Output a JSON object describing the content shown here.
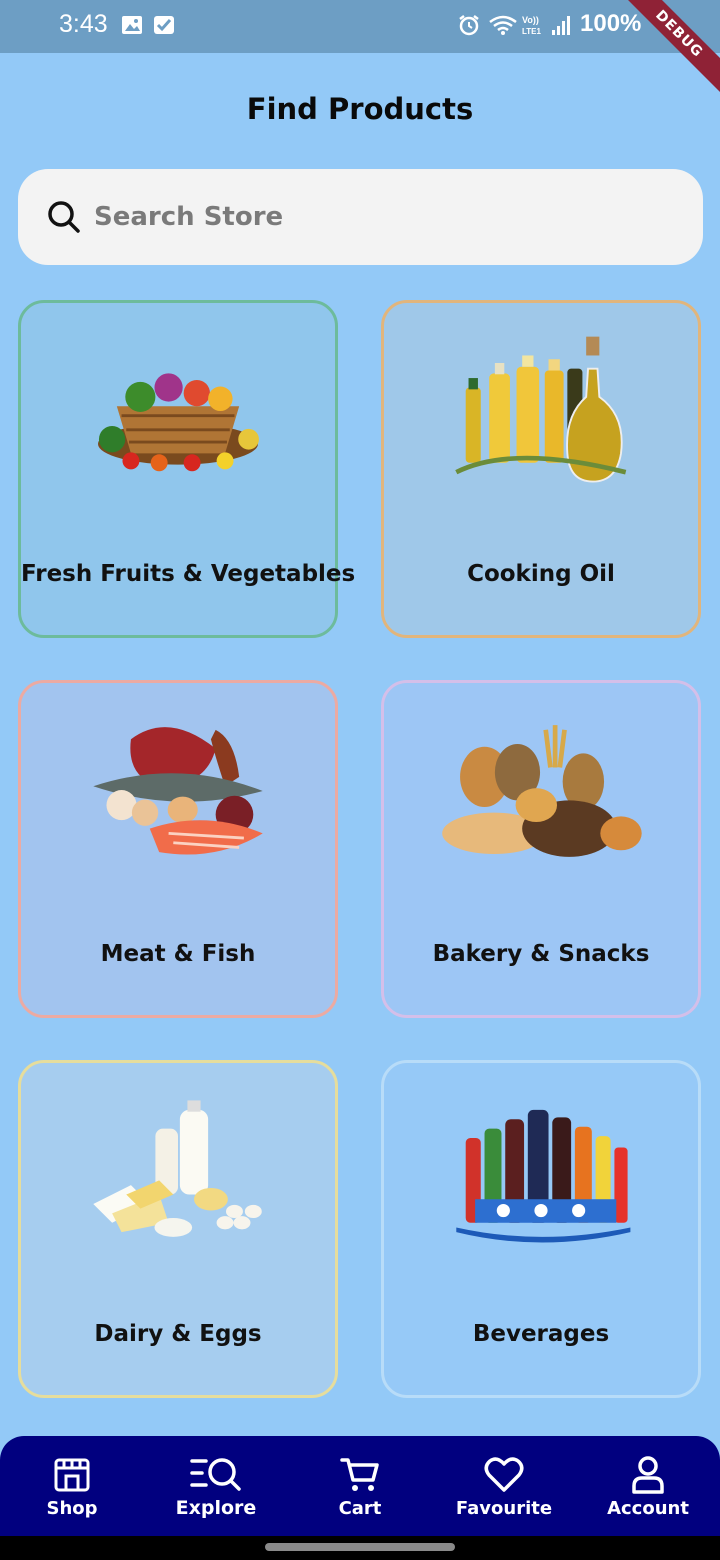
{
  "status_bar": {
    "time": "3:43",
    "battery": "100%",
    "ribbon": "DEBUG"
  },
  "page": {
    "title": "Find Products"
  },
  "search": {
    "placeholder": "Search Store",
    "value": ""
  },
  "categories": [
    {
      "label": "Fresh Fruits & Vegetables",
      "icon": "fruits-vegetables-basket-image",
      "border": "#6dbb9c",
      "bg": "#90c6ec"
    },
    {
      "label": "Cooking Oil",
      "icon": "cooking-oil-bottles-image",
      "border": "#e1b57c",
      "bg": "#9fc8e9"
    },
    {
      "label": "Meat & Fish",
      "icon": "meat-fish-image",
      "border": "#ecaaa2",
      "bg": "#a2c4ef"
    },
    {
      "label": "Bakery & Snacks",
      "icon": "bakery-bread-image",
      "border": "#d4bfe9",
      "bg": "#9dc6f5"
    },
    {
      "label": "Dairy & Eggs",
      "icon": "dairy-eggs-image",
      "border": "#e6dd9c",
      "bg": "#a6cdef"
    },
    {
      "label": "Beverages",
      "icon": "beverage-bottles-image",
      "border": "#b8dcf8",
      "bg": "#96c9f7"
    }
  ],
  "bottom_nav": {
    "items": [
      {
        "label": "Shop",
        "icon": "shop-icon"
      },
      {
        "label": "Explore",
        "icon": "explore-icon"
      },
      {
        "label": "Cart",
        "icon": "cart-icon"
      },
      {
        "label": "Favourite",
        "icon": "heart-icon"
      },
      {
        "label": "Account",
        "icon": "account-icon"
      }
    ]
  },
  "colors": {
    "background": "#93c9f7",
    "nav_background": "#01007f",
    "search_background": "#f3f3f3"
  }
}
